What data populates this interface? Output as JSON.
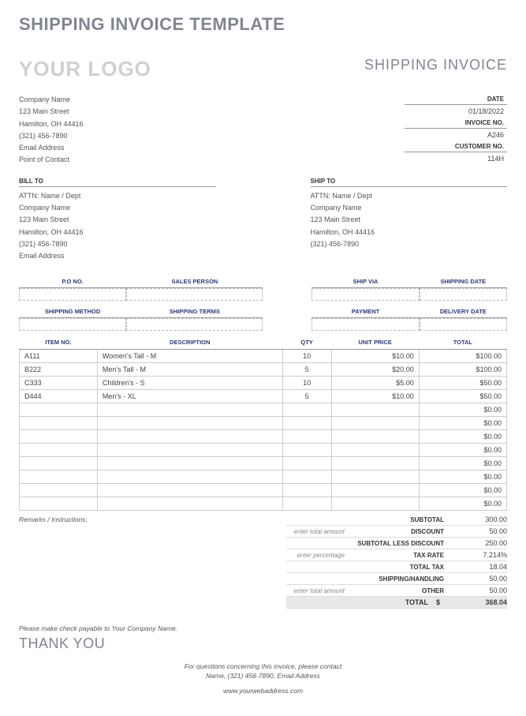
{
  "template_title": "SHIPPING INVOICE TEMPLATE",
  "logo_text": "YOUR LOGO",
  "doc_title": "SHIPPING INVOICE",
  "company": {
    "name": "Company Name",
    "street": "123 Main Street",
    "city": "Hamilton, OH 44416",
    "phone": "(321) 456-7890",
    "email": "Email Address",
    "contact": "Point of Contact"
  },
  "meta": {
    "date_label": "DATE",
    "date_value": "01/18/2022",
    "invoice_label": "INVOICE NO.",
    "invoice_value": "A246",
    "customer_label": "CUSTOMER NO.",
    "customer_value": "114H"
  },
  "bill": {
    "title": "BILL TO",
    "attn": "ATTN: Name / Dept",
    "company": "Company Name",
    "street": "123 Main Street",
    "city": "Hamilton, OH 44416",
    "phone": "(321) 456-7890",
    "email": "Email Address"
  },
  "ship": {
    "title": "SHIP TO",
    "attn": "ATTN: Name / Dept",
    "company": "Company Name",
    "street": "123 Main Street",
    "city": "Hamilton, OH 44416",
    "phone": "(321) 456-7890"
  },
  "detail_headers": {
    "po": "P.O NO.",
    "sales": "SALES PERSON",
    "ship_via": "SHIP VIA",
    "ship_date": "SHIPPING DATE",
    "method": "SHIPPING METHOD",
    "terms": "SHIPPING TERMS",
    "payment": "PAYMENT",
    "delivery": "DELIVERY DATE"
  },
  "item_headers": {
    "no": "ITEM NO.",
    "desc": "DESCRIPTION",
    "qty": "QTY",
    "price": "UNIT PRICE",
    "total": "TOTAL"
  },
  "items": [
    {
      "no": "A111",
      "desc": "Women's Tall - M",
      "qty": "10",
      "price": "$10.00",
      "total": "$100.00"
    },
    {
      "no": "B222",
      "desc": "Men's Tall - M",
      "qty": "5",
      "price": "$20.00",
      "total": "$100.00"
    },
    {
      "no": "C333",
      "desc": "Children's - S",
      "qty": "10",
      "price": "$5.00",
      "total": "$50.00"
    },
    {
      "no": "D444",
      "desc": "Men's - XL",
      "qty": "5",
      "price": "$10.00",
      "total": "$50.00"
    },
    {
      "no": "",
      "desc": "",
      "qty": "",
      "price": "",
      "total": "$0.00"
    },
    {
      "no": "",
      "desc": "",
      "qty": "",
      "price": "",
      "total": "$0.00"
    },
    {
      "no": "",
      "desc": "",
      "qty": "",
      "price": "",
      "total": "$0.00"
    },
    {
      "no": "",
      "desc": "",
      "qty": "",
      "price": "",
      "total": "$0.00"
    },
    {
      "no": "",
      "desc": "",
      "qty": "",
      "price": "",
      "total": "$0.00"
    },
    {
      "no": "",
      "desc": "",
      "qty": "",
      "price": "",
      "total": "$0.00"
    },
    {
      "no": "",
      "desc": "",
      "qty": "",
      "price": "",
      "total": "$0.00"
    },
    {
      "no": "",
      "desc": "",
      "qty": "",
      "price": "",
      "total": "$0.00"
    }
  ],
  "remarks_label": "Remarks / Instructions:",
  "totals": {
    "subtotal_label": "SUBTOTAL",
    "subtotal_val": "300.00",
    "discount_hint": "enter total amount",
    "discount_label": "DISCOUNT",
    "discount_val": "50.00",
    "subless_label": "SUBTOTAL LESS DISCOUNT",
    "subless_val": "250.00",
    "tax_hint": "enter percentage",
    "tax_label": "TAX RATE",
    "tax_val": "7.214%",
    "totaltax_label": "TOTAL TAX",
    "totaltax_val": "18.04",
    "shiphand_label": "SHIPPING/HANDLING",
    "shiphand_val": "50.00",
    "other_hint": "enter total amount",
    "other_label": "OTHER",
    "other_val": "50.00",
    "total_label": "TOTAL",
    "total_cur": "$",
    "total_val": "368.04"
  },
  "payable": "Please make check payable to Your Company Name.",
  "thanks": "THANK YOU",
  "footer": {
    "line1": "For questions concerning this invoice, please contact",
    "line2": "Name, (321) 456-7890, Email Address",
    "web": "www.yourwebaddress.com"
  }
}
